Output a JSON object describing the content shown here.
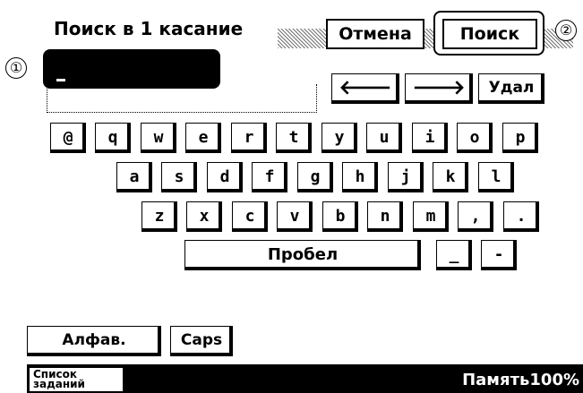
{
  "header": {
    "title": "Поиск в 1 касание"
  },
  "callouts": {
    "one": "①",
    "two": "②"
  },
  "buttons": {
    "cancel": "Отмена",
    "search": "Поиск",
    "delete": "Удал",
    "left_arrow": "🡐",
    "right_arrow": "🡒"
  },
  "keyboard": {
    "row1": [
      "@",
      "q",
      "w",
      "e",
      "r",
      "t",
      "y",
      "u",
      "i",
      "o",
      "p"
    ],
    "row2": [
      "a",
      "s",
      "d",
      "f",
      "g",
      "h",
      "j",
      "k",
      "l"
    ],
    "row3": [
      "z",
      "x",
      "c",
      "v",
      "b",
      "n",
      "m",
      ",",
      "."
    ],
    "space": "Пробел",
    "underscore": "_",
    "dash": "-"
  },
  "mode_buttons": {
    "alpha": "Алфав.",
    "caps": "Caps"
  },
  "statusbar": {
    "jobs_line1": "Список",
    "jobs_line2": "заданий",
    "memory": "Память100%"
  },
  "input": {
    "value": ""
  }
}
